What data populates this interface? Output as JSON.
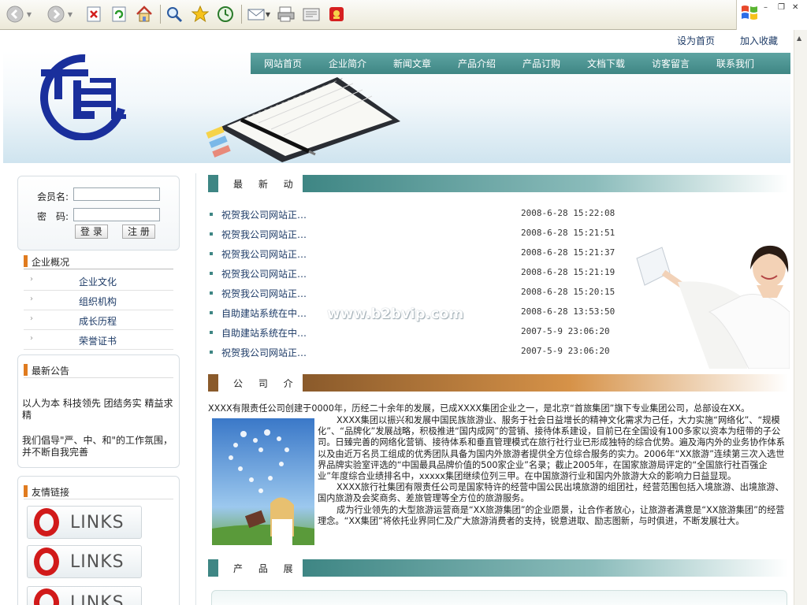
{
  "toolbar": {
    "icons": [
      "back-icon",
      "forward-icon",
      "stop-icon",
      "refresh-icon",
      "home-icon",
      "search-icon",
      "favorites-icon",
      "history-icon",
      "mail-icon",
      "print-icon",
      "edit-icon",
      "messenger-icon"
    ]
  },
  "top_links": [
    "设为首页",
    "加入收藏"
  ],
  "nav": [
    "网站首页",
    "企业简介",
    "新闻文章",
    "产品介绍",
    "产品订购",
    "文档下载",
    "访客留言",
    "联系我们"
  ],
  "login": {
    "member_label": "会员名:",
    "password_label": "密　码:",
    "login_button": "登 录",
    "register_button": "注 册"
  },
  "company_section": {
    "title": "企业概况",
    "items": [
      "企业文化",
      "组织机构",
      "成长历程",
      "荣誉证书"
    ]
  },
  "notice": {
    "title": "最新公告",
    "paragraph1": "以人为本 科技领先 团结务实 精益求精",
    "paragraph2": "我们倡导\"严、中、和\"的工作氛围，并不断自我完善"
  },
  "friend_links": {
    "title": "友情链接",
    "buttons": [
      "LINKS",
      "LINKS",
      "LINKS"
    ]
  },
  "news": {
    "title": "最 新 动 态",
    "items": [
      {
        "title": "祝贺我公司网站正…",
        "date": "2008-6-28 15:22:08"
      },
      {
        "title": "祝贺我公司网站正…",
        "date": "2008-6-28 15:21:51"
      },
      {
        "title": "祝贺我公司网站正…",
        "date": "2008-6-28 15:21:37"
      },
      {
        "title": "祝贺我公司网站正…",
        "date": "2008-6-28 15:21:19"
      },
      {
        "title": "祝贺我公司网站正…",
        "date": "2008-6-28 15:20:15"
      },
      {
        "title": "自助建站系统在中…",
        "date": "2008-6-28 13:53:50"
      },
      {
        "title": "自助建站系统在中…",
        "date": "2007-5-9 23:06:20"
      },
      {
        "title": "祝贺我公司网站正…",
        "date": "2007-5-9 23:06:20"
      }
    ]
  },
  "watermark": "www.b2bvip.com",
  "company_intro": {
    "title": "公 司 介 绍",
    "first_line": "XXXX有限责任公司创建于0000年，历经二十余年的发展，已成XXXX集团企业之一，是北京“首旅集团”旗下专业集团公司，总部设在XX。",
    "p1": "XXXX集团以振兴和发展中国民族旅游业、服务于社会日益增长的精神文化需求为己任，大力实施“网络化”、“规模化”、“品牌化”发展战略，积极推进“国内成网”的营销、接待体系建设，目前已在全国设有100多家以资本为纽带的子公司。日臻完善的网络化营销、接待体系和垂直管理模式在旅行社行业已形成独特的综合优势。遍及海内外的业务协作体系以及由近万名员工组成的优秀团队具备为国内外旅游者提供全方位综合服务的实力。2006年“XX旅游”连续第三次入选世界品牌实验室评选的“中国最具品牌价值的500家企业”名录；截止2005年，在国家旅游局评定的“全国旅行社百强企业”年度综合业绩排名中，xxxxx集团继续位列三甲。在中国旅游行业和国内外旅游大众的影响力日益显现。",
    "p2": "XXXX旅行社集团有限责任公司是国家特许的经营中国公民出境旅游的组团社，经营范围包括入境旅游、出境旅游、国内旅游及会奖商务、差旅管理等全方位的旅游服务。",
    "p3": "成为行业领先的大型旅游运营商是“XX旅游集团”的企业愿景，让合作者放心，让旅游者满意是“XX旅游集团”的经营理念。“XX集团”将依托业界同仁及广大旅游消费者的支持，锐意进取、励志图新，与时俱进，不断发展壮大。"
  },
  "products": {
    "title": "产 品 展 示"
  },
  "colors": {
    "teal": "#3e8684",
    "brown": "#8a5a2b",
    "logo_blue": "#1a2f9c",
    "orange_bar": "#e07b1f"
  }
}
